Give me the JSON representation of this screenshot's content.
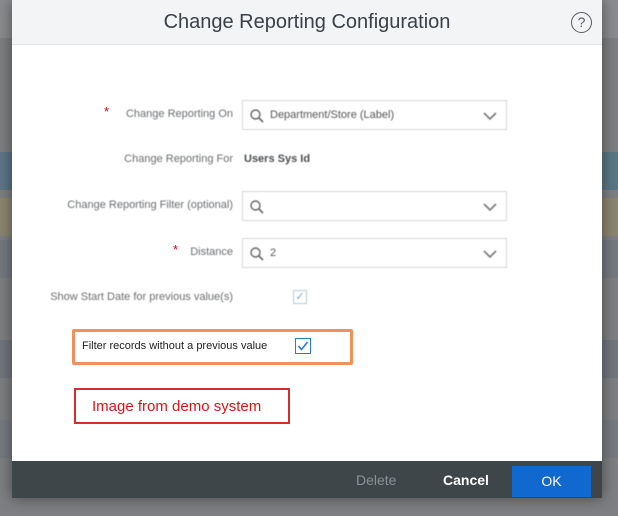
{
  "dialog": {
    "title": "Change Reporting Configuration",
    "help_icon": "question-circle-icon"
  },
  "form": {
    "change_reporting_on": {
      "label": "Change Reporting On",
      "required": true,
      "value": "Department/Store (Label)"
    },
    "change_reporting_for": {
      "label": "Change Reporting For",
      "value": "Users Sys Id"
    },
    "change_reporting_filter": {
      "label": "Change Reporting Filter (optional)",
      "value": ""
    },
    "distance": {
      "label": "Distance",
      "required": true,
      "value": "2"
    },
    "show_start_date": {
      "label": "Show Start Date for previous value(s)",
      "checked": true
    },
    "filter_records": {
      "label": "Filter records without a previous value",
      "checked": true
    }
  },
  "annotation": {
    "text": "Image from demo system"
  },
  "footer": {
    "delete_label": "Delete",
    "cancel_label": "Cancel",
    "ok_label": "OK"
  },
  "colors": {
    "header_bg": "#f3f4f5",
    "footer_bg": "#3e4649",
    "primary": "#1168cf",
    "highlight_border": "#f0915c",
    "annotation_red": "#d9151a",
    "required": "#d5001a"
  }
}
